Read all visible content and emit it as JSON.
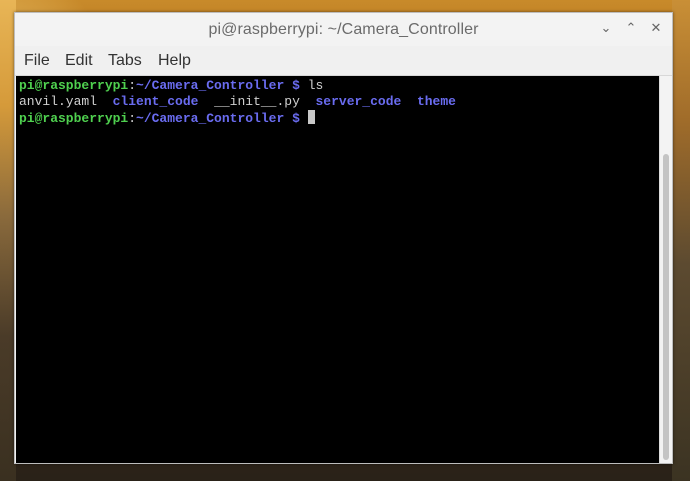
{
  "window": {
    "title": "pi@raspberrypi: ~/Camera_Controller",
    "controls": {
      "minimize_glyph": "⌄",
      "maximize_glyph": "⌃",
      "close_glyph": "✕"
    }
  },
  "menubar": {
    "items": [
      "File",
      "Edit",
      "Tabs",
      "Help"
    ]
  },
  "terminal": {
    "prompt_user": "pi@raspberrypi",
    "prompt_colon": ":",
    "prompt_path": "~/Camera_Controller",
    "prompt_dollar": "$",
    "command": "ls",
    "listing": [
      {
        "name": "anvil.yaml",
        "type": "file"
      },
      {
        "name": "client_code",
        "type": "dir"
      },
      {
        "name": "__init__.py",
        "type": "file"
      },
      {
        "name": "server_code",
        "type": "dir"
      },
      {
        "name": "theme",
        "type": "dir"
      }
    ]
  },
  "colors": {
    "prompt_user": "#4fd04f",
    "prompt_path": "#6a6cf0",
    "directory": "#6a6cf0",
    "text": "#d0d0d0",
    "background": "#000000"
  },
  "icons": {
    "minimize": "chevron-down-icon",
    "maximize": "chevron-up-icon",
    "close": "close-icon"
  }
}
